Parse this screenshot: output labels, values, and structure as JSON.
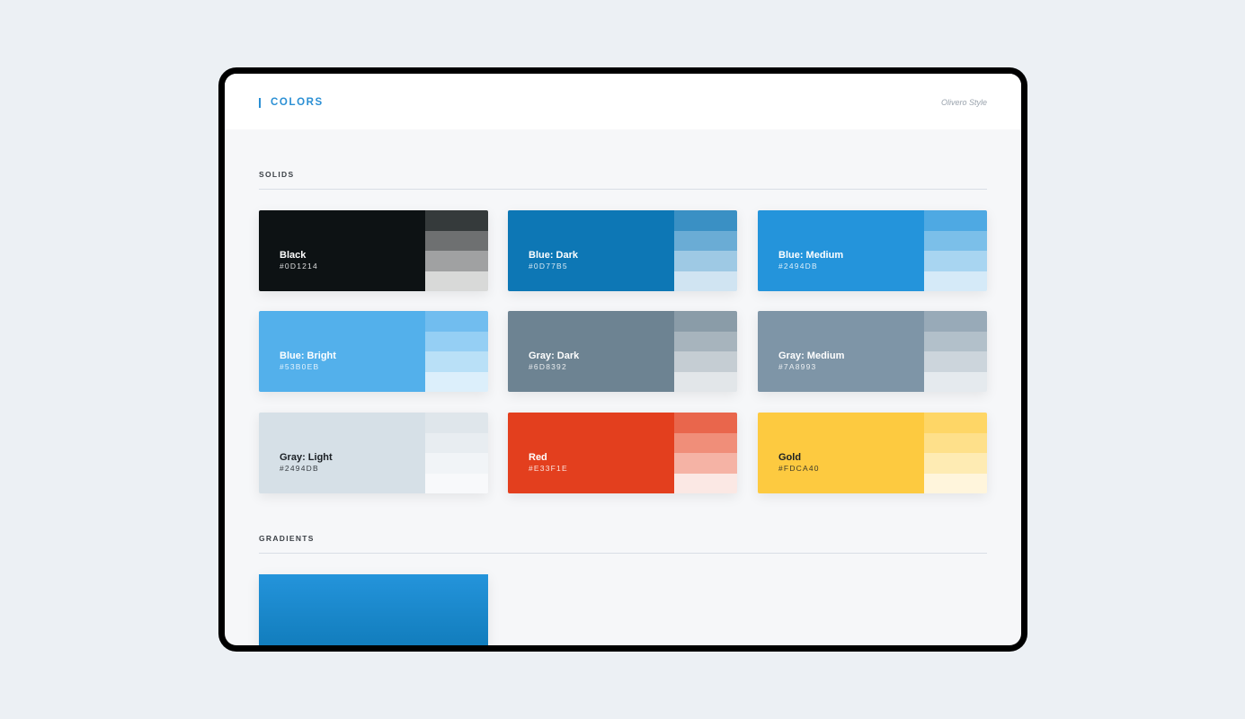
{
  "header": {
    "title": "COLORS",
    "style_name": "Olivero Style",
    "accent": "#2a8fd4"
  },
  "sections": {
    "solids": "SOLIDS",
    "gradients": "GRADIENTS"
  },
  "swatches": [
    {
      "name": "Black",
      "hex": "#0D1214",
      "color": "#0d1214",
      "text": "#ffffff",
      "tints": [
        "#353a3b",
        "#6e7071",
        "#a0a1a2",
        "#d8d9d8"
      ]
    },
    {
      "name": "Blue: Dark",
      "hex": "#0D77B5",
      "color": "#0d77b5",
      "text": "#ffffff",
      "tints": [
        "#3a90c4",
        "#6aacd5",
        "#9ec9e4",
        "#d0e4f2"
      ]
    },
    {
      "name": "Blue: Medium",
      "hex": "#2494DB",
      "color": "#2494db",
      "text": "#ffffff",
      "tints": [
        "#4ea9e3",
        "#7bbfe9",
        "#a8d5f1",
        "#d5eaf8"
      ]
    },
    {
      "name": "Blue: Bright",
      "hex": "#53B0EB",
      "color": "#53b0eb",
      "text": "#ffffff",
      "tints": [
        "#71bdef",
        "#95cff4",
        "#b9e0f7",
        "#dceffb"
      ]
    },
    {
      "name": "Gray: Dark",
      "hex": "#6D8392",
      "color": "#6d8392",
      "text": "#ffffff",
      "tints": [
        "#8a9ca8",
        "#a7b4bd",
        "#c5cdd3",
        "#e2e6e9"
      ]
    },
    {
      "name": "Gray: Medium",
      "hex": "#7A8993",
      "color": "#7e95a7",
      "text": "#ffffff",
      "tints": [
        "#98aab8",
        "#b2c0ca",
        "#ccd5dc",
        "#e5eaee"
      ]
    },
    {
      "name": "Gray: Light",
      "hex": "#2494DB",
      "color": "#d6e0e7",
      "text": "#1a1f24",
      "tints": [
        "#dfe6eb",
        "#e8edf1",
        "#f1f4f7",
        "#f8f9fb"
      ]
    },
    {
      "name": "Red",
      "hex": "#E33F1E",
      "color": "#e33f1e",
      "text": "#ffffff",
      "tints": [
        "#e9664c",
        "#f08e79",
        "#f5b3a5",
        "#fbe8e4"
      ]
    },
    {
      "name": "Gold",
      "hex": "#FDCA40",
      "color": "#fdca40",
      "text": "#1a1f24",
      "tints": [
        "#fed666",
        "#fee08a",
        "#feebb3",
        "#fff5dc"
      ]
    }
  ],
  "gradient": {
    "from": "#2494db",
    "to": "#0d77b5"
  }
}
